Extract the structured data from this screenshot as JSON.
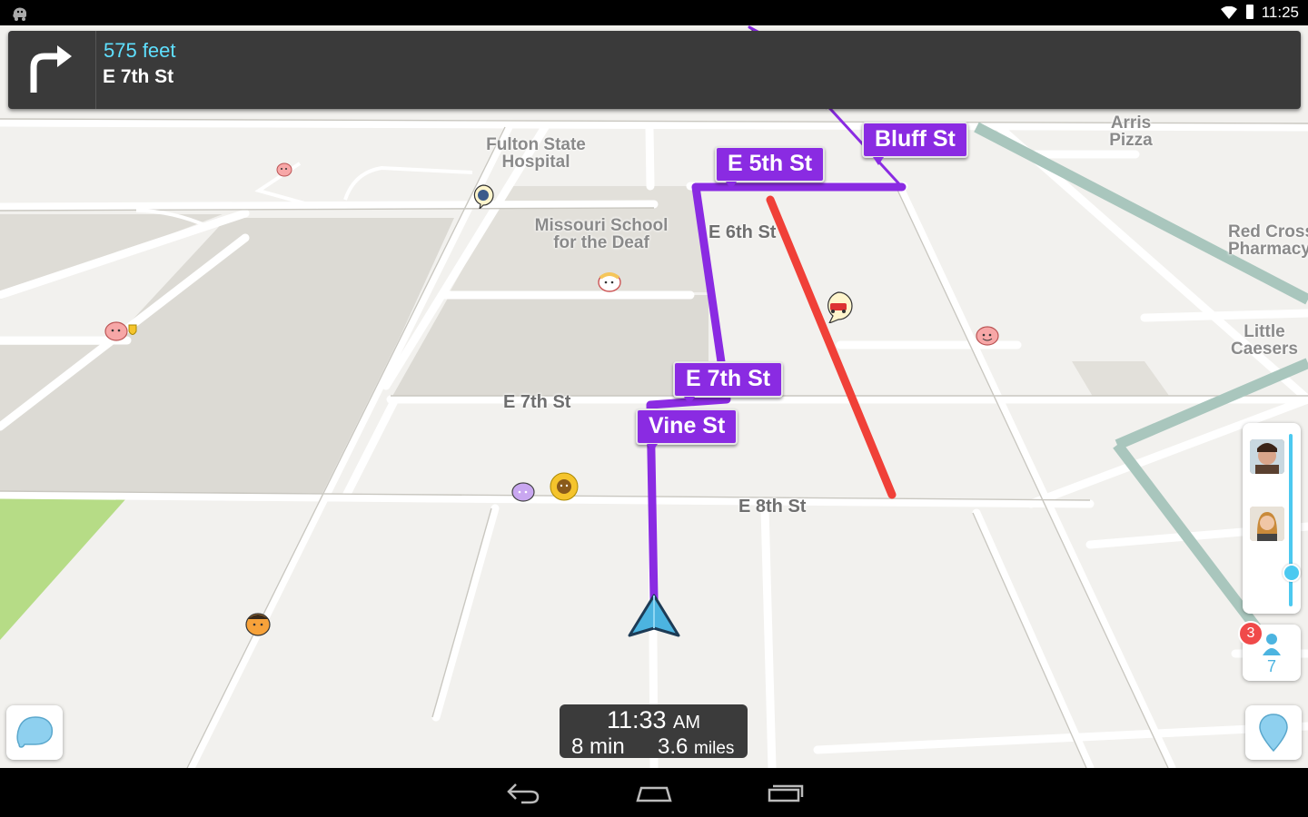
{
  "status_bar": {
    "time": "11:25"
  },
  "navigation": {
    "distance": "575 feet",
    "street": "E 7th St"
  },
  "street_labels": {
    "e6th": "E 6th St",
    "e7th": "E 7th St",
    "e8th": "E 8th St"
  },
  "route_tags": {
    "bluff": "Bluff St",
    "e5th": "E 5th St",
    "e7th": "E 7th St",
    "vine": "Vine St"
  },
  "pois": {
    "fulton": [
      "Fulton State",
      "Hospital"
    ],
    "missouri": [
      "Missouri School",
      "for the Deaf"
    ],
    "arris": [
      "Arris",
      "Pizza"
    ],
    "redcross": [
      "Red Cross",
      "Pharmacy"
    ],
    "caesers": [
      "Little",
      "Caesers"
    ]
  },
  "eta": {
    "time": "11:33",
    "ampm": "AM",
    "duration": "8 min",
    "distance_value": "3.6",
    "distance_unit": "miles"
  },
  "wazers": {
    "badge": "3",
    "count": "7"
  },
  "colors": {
    "route": "#8a2be2",
    "traffic": "#f04038",
    "banner": "#3a3a3a",
    "accent": "#5fe0ff",
    "park": "#b6dc86"
  },
  "icons": {
    "turn": "turn-right-icon",
    "report": "report-bubble-icon",
    "pin": "location-pin-icon",
    "user": "user-icon",
    "back": "back-icon",
    "home": "home-icon",
    "recents": "recents-icon"
  }
}
